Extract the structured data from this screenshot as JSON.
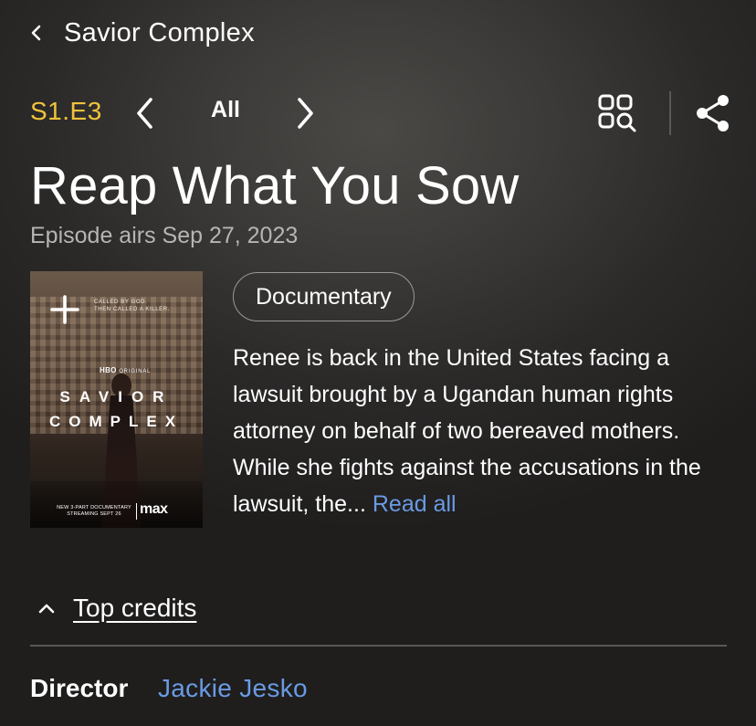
{
  "header": {
    "back_icon": "chevron-left-icon",
    "title": "Savior Complex"
  },
  "episode_nav": {
    "code": "S1.E3",
    "prev_icon": "chevron-left-icon",
    "all_label": "All",
    "next_icon": "chevron-right-icon",
    "grid_icon": "episode-grid-search-icon",
    "share_icon": "share-icon"
  },
  "episode": {
    "title": "Reap What You Sow",
    "airs": "Episode airs Sep 27, 2023",
    "genre": "Documentary",
    "synopsis": "Renee is back in the United States facing a lawsuit brought by a Ugandan human rights attorney on behalf of two bereaved mothers. While she fights against the accusations in the lawsuit, the...",
    "read_all_label": "Read all"
  },
  "poster": {
    "add_icon": "plus-icon",
    "tagline_1": "CALLED BY GOD.",
    "tagline_2": "THEN CALLED A KILLER.",
    "network": "HBO",
    "network_suffix": "ORIGINAL",
    "title_line_1": "SAVIOR",
    "title_line_2": "COMPLEX",
    "footer_1": "NEW 3-PART DOCUMENTARY",
    "footer_2": "STREAMING SEPT 26",
    "brand": "max"
  },
  "credits": {
    "toggle_icon": "chevron-up-icon",
    "label": "Top credits",
    "director_label": "Director",
    "director_name": "Jackie Jesko"
  },
  "colors": {
    "accent_gold": "#f1c33b",
    "link_blue": "#6a9ae4",
    "secondary_text": "#b7b5b3"
  }
}
